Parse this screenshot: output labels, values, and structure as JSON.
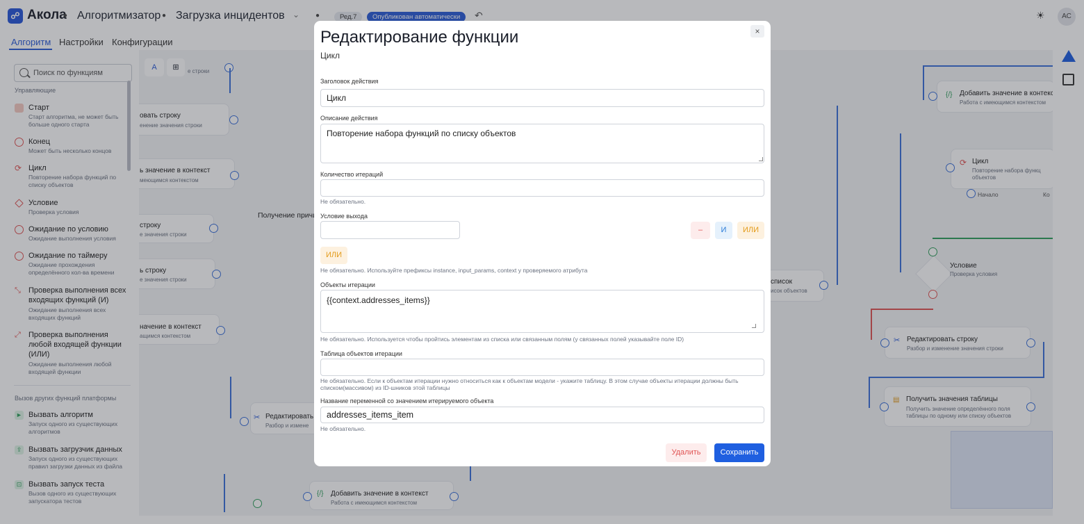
{
  "header": {
    "logo_glyph": "☍",
    "brand": "Акола",
    "crumbs": [
      "Алгоритмизатор",
      "Загрузка инцидентов"
    ],
    "version_badge": "Ред.7",
    "status_badge": "Опубликован автоматически",
    "user_initials": "АС"
  },
  "tabs": [
    "Алгоритм",
    "Настройки",
    "Конфигурации"
  ],
  "sidebar": {
    "search_placeholder": "Поиск по функциям",
    "section_control": "Управляющие",
    "control_items": [
      {
        "name": "Старт",
        "desc": "Старт алгоритма, не может быть больше одного старта"
      },
      {
        "name": "Конец",
        "desc": "Может быть несколько концов"
      },
      {
        "name": "Цикл",
        "desc": "Повторение набора функций по списку объектов"
      },
      {
        "name": "Условие",
        "desc": "Проверка условия"
      },
      {
        "name": "Ожидание по условию",
        "desc": "Ожидание выполнения условия"
      },
      {
        "name": "Ожидание по таймеру",
        "desc": "Ожидание прохождения определённого кол-ва времени"
      },
      {
        "name": "Проверка выполнения всех входящих функций (И)",
        "desc": "Ожидание выполнения всех входящих функций"
      },
      {
        "name": "Проверка выполнения любой входящей функции (ИЛИ)",
        "desc": "Ожидание выполнения любой входящей функции"
      }
    ],
    "section_calls": "Вызов других функций платформы",
    "call_items": [
      {
        "name": "Вызвать алгоритм",
        "desc": "Запуск одного из существующих алгоритмов"
      },
      {
        "name": "Вызвать загрузчик данных",
        "desc": "Запуск одного из существующих правил загрузки данных из файла"
      },
      {
        "name": "Вызвать запуск теста",
        "desc": "Вызов одного из существующих запускатора тестов"
      }
    ]
  },
  "canvas": {
    "nodes_left": [
      {
        "title": "овать строку",
        "sub": "енение значения строки"
      },
      {
        "title": "ь значение в контекст",
        "sub": "меющимся контекстом"
      },
      {
        "title": "строку",
        "sub": "е значения строки"
      },
      {
        "title": "ь строку",
        "sub": "е значения строки"
      },
      {
        "title": "начение в контекст",
        "sub": "ащимся контекстом"
      }
    ],
    "node_top_sub": "е строки",
    "label_get": "Получение причи",
    "node_edit_left": {
      "title": "Редактировать",
      "sub": "Разбор и измене"
    },
    "node_list": {
      "title": "список",
      "sub": "исок объектов"
    },
    "node_add_bottom": {
      "title": "Добавить значение в контекст",
      "sub": "Работа с имеющимся контекстом"
    },
    "right_nodes": {
      "add_ctx": {
        "title": "Добавить значение в контекс",
        "sub": "Работа с имеющимся контекстом"
      },
      "loop": {
        "title": "Цикл",
        "sub": "Повторение набора функц объектов",
        "ports": [
          "Начало",
          "Ко"
        ]
      },
      "condition": {
        "title": "Условие",
        "sub": "Проверка условия"
      },
      "edit_row": {
        "title": "Редактировать строку",
        "sub": "Разбор и изменение значения строки"
      },
      "get_table": {
        "title": "Получить значения таблицы",
        "sub": "Получить значение определённого поля таблицы по одному или списку объектов"
      }
    }
  },
  "modal": {
    "title": "Редактирование функции",
    "subtitle": "Цикл",
    "close_glyph": "×",
    "fields": {
      "action_title_label": "Заголовок действия",
      "action_title_value": "Цикл",
      "action_desc_label": "Описание действия",
      "action_desc_value": "Повторение набора функций по списку объектов",
      "iterations_label": "Количество итераций",
      "iterations_value": "",
      "iterations_hint": "Не обязательно.",
      "exit_label": "Условие выхода",
      "exit_value": "",
      "chip_minus": "–",
      "chip_and": "И",
      "chip_or": "ИЛИ",
      "chip_or_added": "ИЛИ",
      "exit_hint": "Не обязательно. Используйте префиксы instance, input_params, context у проверяемого атрибута",
      "objects_label": "Объекты итерации",
      "objects_value": "{{context.addresses_items}}",
      "objects_hint": "Не обязательно. Используется чтобы пройтись элементам из списка или связанным полям (у связанных полей указывайте поле ID)",
      "table_label": "Таблица объектов итерации",
      "table_value": "",
      "table_hint": "Не обязательно. Если к объектам итерации нужно относиться как к объектам модели - укажите таблицу. В этом случае объекты итерации должны быть списком(массивом) из ID-шников этой таблицы",
      "var_label": "Название переменной со значением итерируемого объекта",
      "var_value": "addresses_items_item",
      "var_hint": "Не обязательно."
    },
    "delete_label": "Удалить",
    "save_label": "Сохранить"
  }
}
